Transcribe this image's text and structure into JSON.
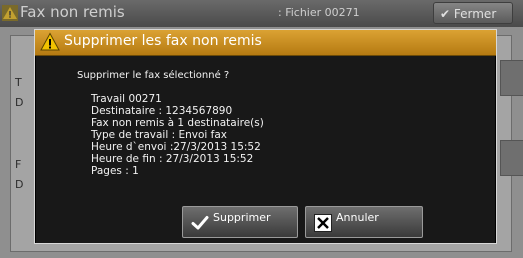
{
  "background": {
    "title": "Fax non remis",
    "file": ": Fichier 00271",
    "close_label": "Fermer",
    "side_letters": [
      "T",
      "D",
      "F",
      "D"
    ]
  },
  "dialog": {
    "title": "Supprimer les fax non remis",
    "question": "Supprimer le fax sélectionné ?",
    "details": [
      "Travail 00271",
      "Destinataire : 1234567890",
      "Fax non remis à 1 destinataire(s)",
      "Type de travail : Envoi fax",
      "Heure d`envoi :27/3/2013 15:52",
      "Heure de fin : 27/3/2013 15:52",
      "Pages : 1"
    ],
    "delete_label": "Supprimer",
    "cancel_label": "Annuler"
  },
  "colors": {
    "header": "#c98c1f",
    "dialog_bg": "#181818",
    "warning_icon": "#f2c200"
  }
}
